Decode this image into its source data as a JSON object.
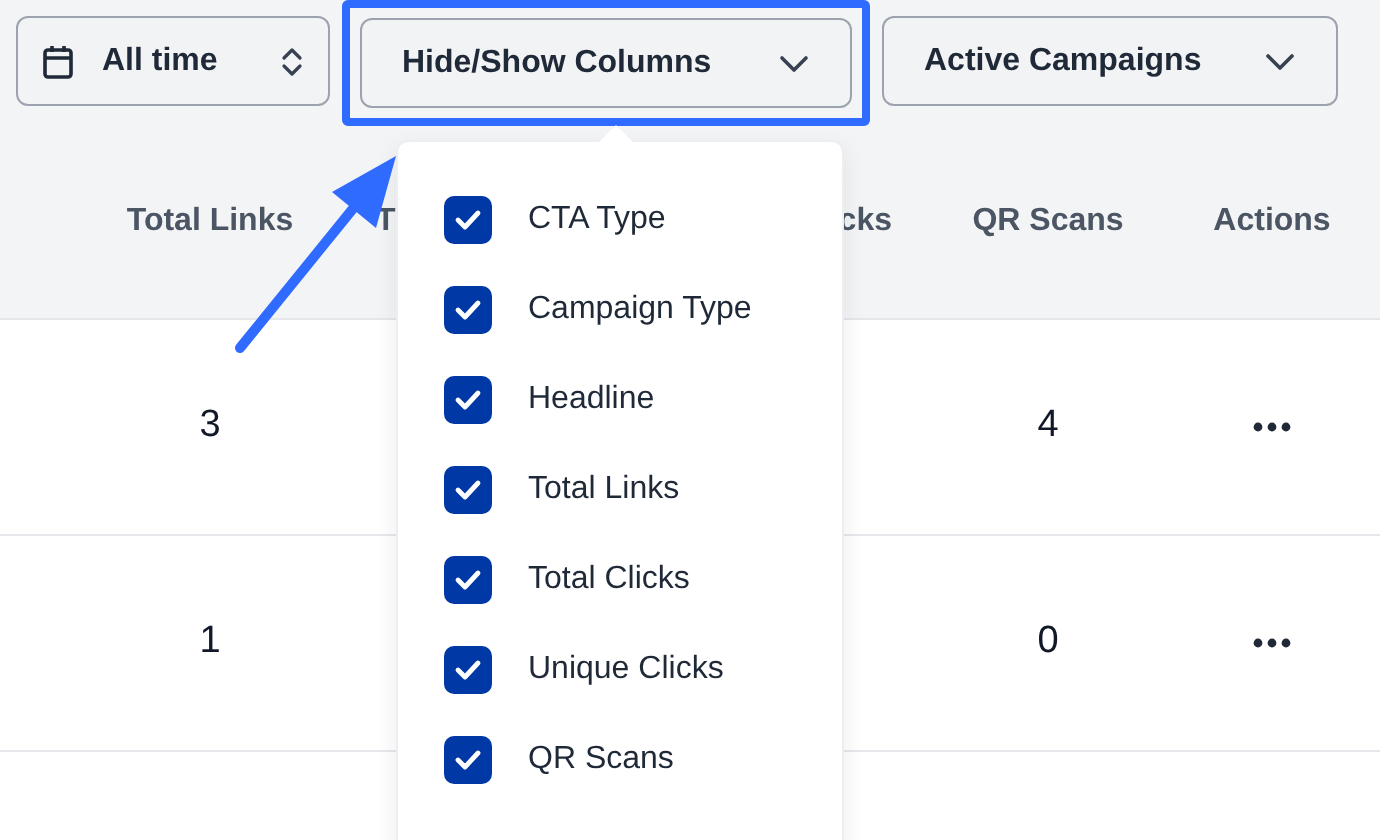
{
  "toolbar": {
    "date_range": {
      "label": "All time"
    },
    "columns_button": {
      "label": "Hide/Show Columns",
      "highlighted": true
    },
    "filter": {
      "label": "Active Campaigns"
    }
  },
  "columns_menu": {
    "items": [
      {
        "label": "CTA Type",
        "checked": true
      },
      {
        "label": "Campaign Type",
        "checked": true
      },
      {
        "label": "Headline",
        "checked": true
      },
      {
        "label": "Total Links",
        "checked": true
      },
      {
        "label": "Total Clicks",
        "checked": true
      },
      {
        "label": "Unique Clicks",
        "checked": true
      },
      {
        "label": "QR Scans",
        "checked": true
      }
    ]
  },
  "table": {
    "columns": [
      "Total Links",
      "T",
      "cks",
      "QR Scans",
      "Actions"
    ],
    "rows": [
      {
        "total_links": "3",
        "qr_scans": "4"
      },
      {
        "total_links": "1",
        "qr_scans": "0"
      }
    ]
  }
}
